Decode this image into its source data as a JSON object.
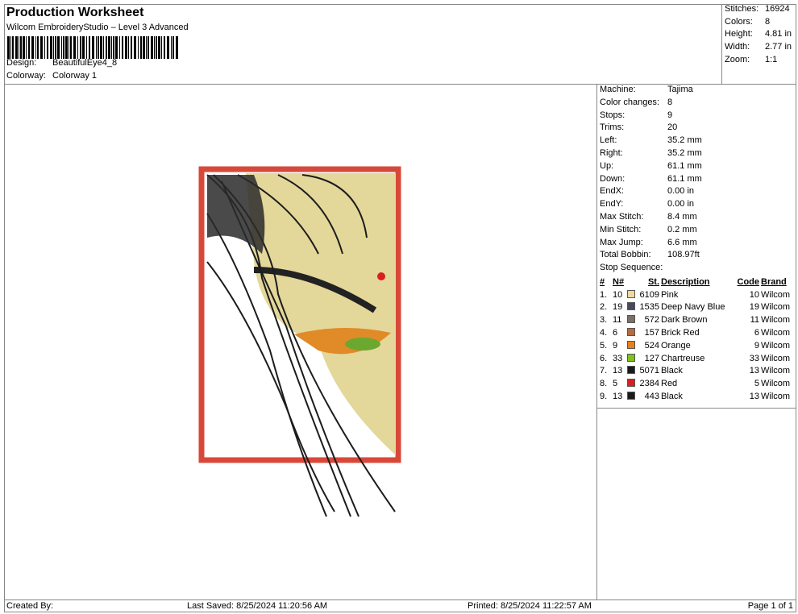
{
  "header": {
    "title": "Production Worksheet",
    "subtitle": "Wilcom EmbroideryStudio – Level 3 Advanced",
    "design_label": "Design:",
    "design": "BeautifulEye4_8",
    "colorway_label": "Colorway:",
    "colorway": "Colorway 1"
  },
  "stats": [
    {
      "k": "Stitches:",
      "v": "16924"
    },
    {
      "k": "Colors:",
      "v": "8"
    },
    {
      "k": "Height:",
      "v": "4.81 in"
    },
    {
      "k": "Width:",
      "v": "2.77 in"
    },
    {
      "k": "Zoom:",
      "v": "1:1"
    }
  ],
  "machine": [
    {
      "k": "Machine:",
      "v": "Tajima"
    },
    {
      "k": "Color changes:",
      "v": "8"
    },
    {
      "k": "Stops:",
      "v": "9"
    },
    {
      "k": "Trims:",
      "v": "20"
    },
    {
      "k": "Left:",
      "v": "35.2 mm"
    },
    {
      "k": "Right:",
      "v": "35.2 mm"
    },
    {
      "k": "Up:",
      "v": "61.1 mm"
    },
    {
      "k": "Down:",
      "v": "61.1 mm"
    },
    {
      "k": "EndX:",
      "v": "0.00 in"
    },
    {
      "k": "EndY:",
      "v": "0.00 in"
    },
    {
      "k": "Max Stitch:",
      "v": "8.4 mm"
    },
    {
      "k": "Min Stitch:",
      "v": "0.2 mm"
    },
    {
      "k": "Max Jump:",
      "v": "6.6 mm"
    },
    {
      "k": "Total Bobbin:",
      "v": "108.97ft"
    }
  ],
  "stop_sequence": {
    "label": "Stop Sequence:",
    "headers": [
      "#",
      "N#",
      "St.",
      "Description",
      "Code",
      "Brand"
    ],
    "rows": [
      {
        "n": "1.",
        "nn": "10",
        "color": "#f0d9a0",
        "st": "6109",
        "desc": "Pink",
        "code": "10",
        "brand": "Wilcom"
      },
      {
        "n": "2.",
        "nn": "19",
        "color": "#4a4a5a",
        "st": "1535",
        "desc": "Deep Navy Blue",
        "code": "19",
        "brand": "Wilcom"
      },
      {
        "n": "3.",
        "nn": "11",
        "color": "#7a7068",
        "st": "572",
        "desc": "Dark Brown",
        "code": "11",
        "brand": "Wilcom"
      },
      {
        "n": "4.",
        "nn": "6",
        "color": "#b86a40",
        "st": "157",
        "desc": "Brick Red",
        "code": "6",
        "brand": "Wilcom"
      },
      {
        "n": "5.",
        "nn": "9",
        "color": "#e8801c",
        "st": "524",
        "desc": "Orange",
        "code": "9",
        "brand": "Wilcom"
      },
      {
        "n": "6.",
        "nn": "33",
        "color": "#80c020",
        "st": "127",
        "desc": "Chartreuse",
        "code": "33",
        "brand": "Wilcom"
      },
      {
        "n": "7.",
        "nn": "13",
        "color": "#1a1a1a",
        "st": "5071",
        "desc": "Black",
        "code": "13",
        "brand": "Wilcom"
      },
      {
        "n": "8.",
        "nn": "5",
        "color": "#d82020",
        "st": "2384",
        "desc": "Red",
        "code": "5",
        "brand": "Wilcom"
      },
      {
        "n": "9.",
        "nn": "13",
        "color": "#1a1a1a",
        "st": "443",
        "desc": "Black",
        "code": "13",
        "brand": "Wilcom"
      }
    ]
  },
  "footer": {
    "created": "Created By:",
    "saved": "Last Saved: 8/25/2024 11:20:56 AM",
    "printed": "Printed: 8/25/2024 11:22:57 AM",
    "page": "Page 1 of 1"
  }
}
